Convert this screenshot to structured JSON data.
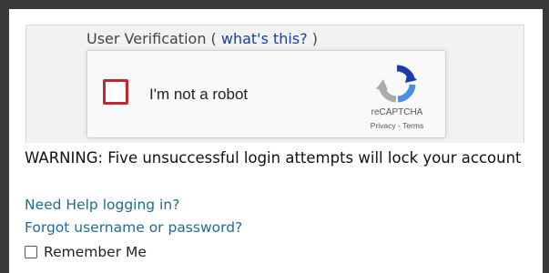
{
  "verification": {
    "heading_prefix": "User Verification ( ",
    "whats_this_link": "what's this?",
    "heading_suffix": " )"
  },
  "recaptcha": {
    "checkbox_label": "I'm not a robot",
    "brand": "reCAPTCHA",
    "legal": "Privacy - Terms",
    "checkbox_border_color": "#c1272d",
    "logo_icon": "recaptcha-logo-icon"
  },
  "warning_text": "WARNING: Five unsuccessful login attempts will lock your account",
  "links": {
    "need_help": "Need Help logging in?",
    "forgot": "Forgot username or password?"
  },
  "remember_me": {
    "label": "Remember Me",
    "checked": false
  },
  "colors": {
    "link": "#1f6e8c",
    "heading_link": "#1a3f9c",
    "frame": "#3a3a3a"
  }
}
